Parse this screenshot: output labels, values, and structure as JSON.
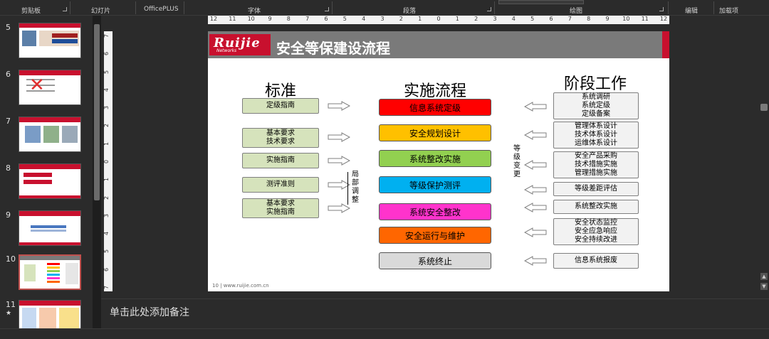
{
  "ribbon": {
    "groups": [
      "剪贴板",
      "幻灯片",
      "OfficePLUS",
      "字体",
      "段落",
      "绘图",
      "编辑",
      "加载项"
    ]
  },
  "thumbnails": [
    {
      "num": "5"
    },
    {
      "num": "6"
    },
    {
      "num": "7"
    },
    {
      "num": "8"
    },
    {
      "num": "9"
    },
    {
      "num": "10"
    },
    {
      "num": "11",
      "star": "★"
    }
  ],
  "hruler": {
    "ticks": [
      "12",
      "11",
      "10",
      "9",
      "8",
      "7",
      "6",
      "5",
      "4",
      "3",
      "2",
      "1",
      "0",
      "1",
      "2",
      "3",
      "4",
      "5",
      "6",
      "7",
      "8",
      "9",
      "10",
      "11",
      "12"
    ]
  },
  "vruler": {
    "ticks": [
      "7",
      "6",
      "5",
      "4",
      "3",
      "2",
      "1",
      "0",
      "1",
      "2",
      "3",
      "4",
      "5",
      "6",
      "7"
    ]
  },
  "slide": {
    "logo_main": "Ruijie",
    "logo_sub": "Networks",
    "title": "安全等保建设流程",
    "col_standard": "标准",
    "col_process": "实施流程",
    "col_work": "阶段工作",
    "standards": [
      {
        "lines": [
          "定级指南"
        ]
      },
      {
        "lines": [
          "基本要求",
          "技术要求"
        ]
      },
      {
        "lines": [
          "实施指南"
        ]
      },
      {
        "lines": [
          "测评准则"
        ]
      },
      {
        "lines": [
          "基本要求",
          "实施指南"
        ]
      }
    ],
    "process": [
      {
        "label": "信息系统定级",
        "color": "#ff0000"
      },
      {
        "label": "安全规划设计",
        "color": "#ffc000"
      },
      {
        "label": "系统整改实施",
        "color": "#92d050"
      },
      {
        "label": "等级保护测评",
        "color": "#00b0f0"
      },
      {
        "label": "系统安全整改",
        "color": "#ff33cc"
      },
      {
        "label": "安全运行与维护",
        "color": "#ff6600"
      },
      {
        "label": "系统终止",
        "color": "#d9d9d9"
      }
    ],
    "work": [
      {
        "lines": [
          "系统调研",
          "系统定级",
          "定级备案"
        ]
      },
      {
        "lines": [
          "管理体系设计",
          "技术体系设计",
          "运维体系设计"
        ]
      },
      {
        "lines": [
          "安全产品采购",
          "技术措施实施",
          "管理措施实施"
        ]
      },
      {
        "lines": [
          "等级差距评估"
        ]
      },
      {
        "lines": [
          "系统整改实施"
        ]
      },
      {
        "lines": [
          "安全状态监控",
          "安全应急响应",
          "安全持续改进"
        ]
      },
      {
        "lines": [
          "信息系统报废"
        ]
      }
    ],
    "local_adjust": "局部调整",
    "level_change": "等级变更",
    "footer": "10 | www.ruijie.com.cn"
  },
  "notes": {
    "placeholder": "单击此处添加备注"
  }
}
